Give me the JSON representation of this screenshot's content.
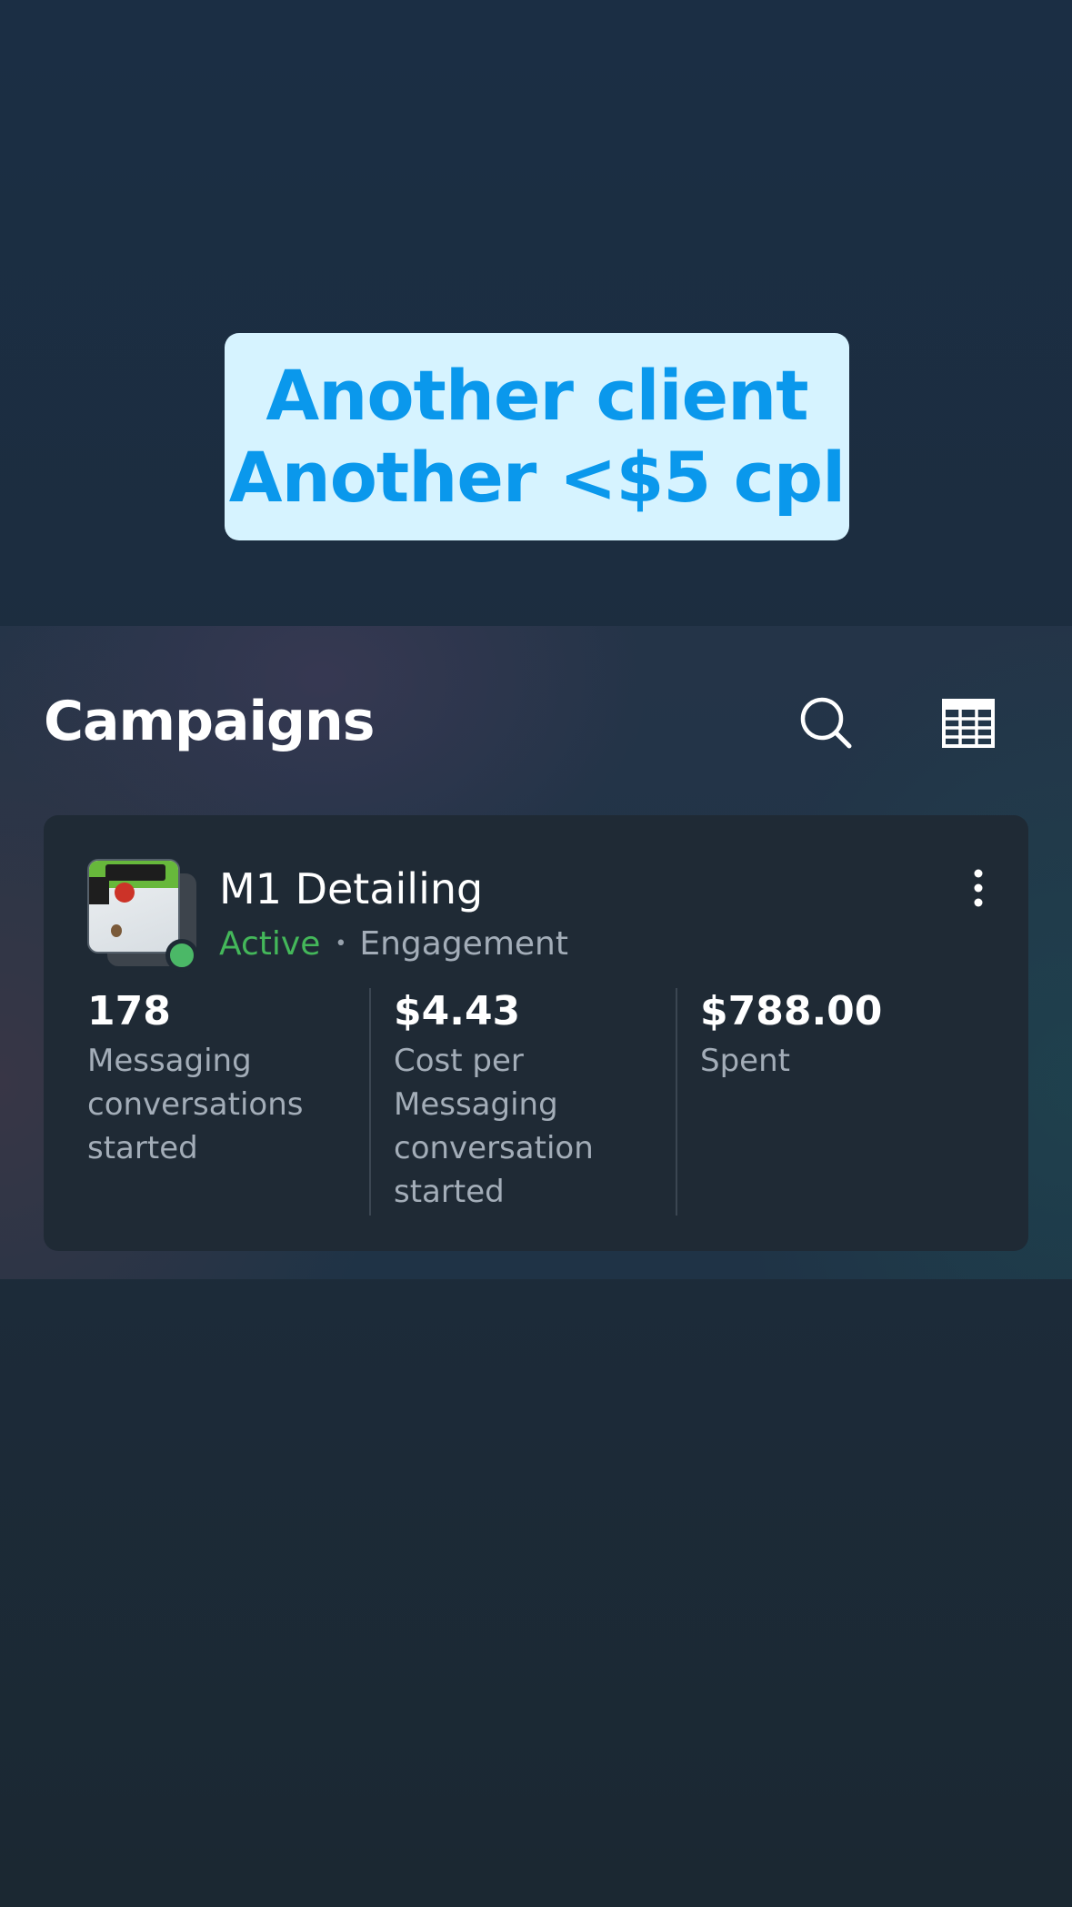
{
  "caption": {
    "line1": "Another client",
    "line2": "Another <$5 cpl",
    "background": "#d6f3ff",
    "text_color": "#0a98ec"
  },
  "header": {
    "title": "Campaigns",
    "search_icon": "search-icon",
    "table_icon": "table-icon"
  },
  "campaign": {
    "name": "M1 Detailing",
    "status": "Active",
    "status_color": "#44b85a",
    "separator": "•",
    "objective": "Engagement",
    "more_icon": "more-vertical-icon",
    "metrics": [
      {
        "value": "178",
        "label": "Messaging\nconversations\nstarted"
      },
      {
        "value": "$4.43",
        "label": "Cost per\nMessaging\nconversation\nstarted"
      },
      {
        "value": "$788.00",
        "label": "Spent"
      }
    ]
  }
}
